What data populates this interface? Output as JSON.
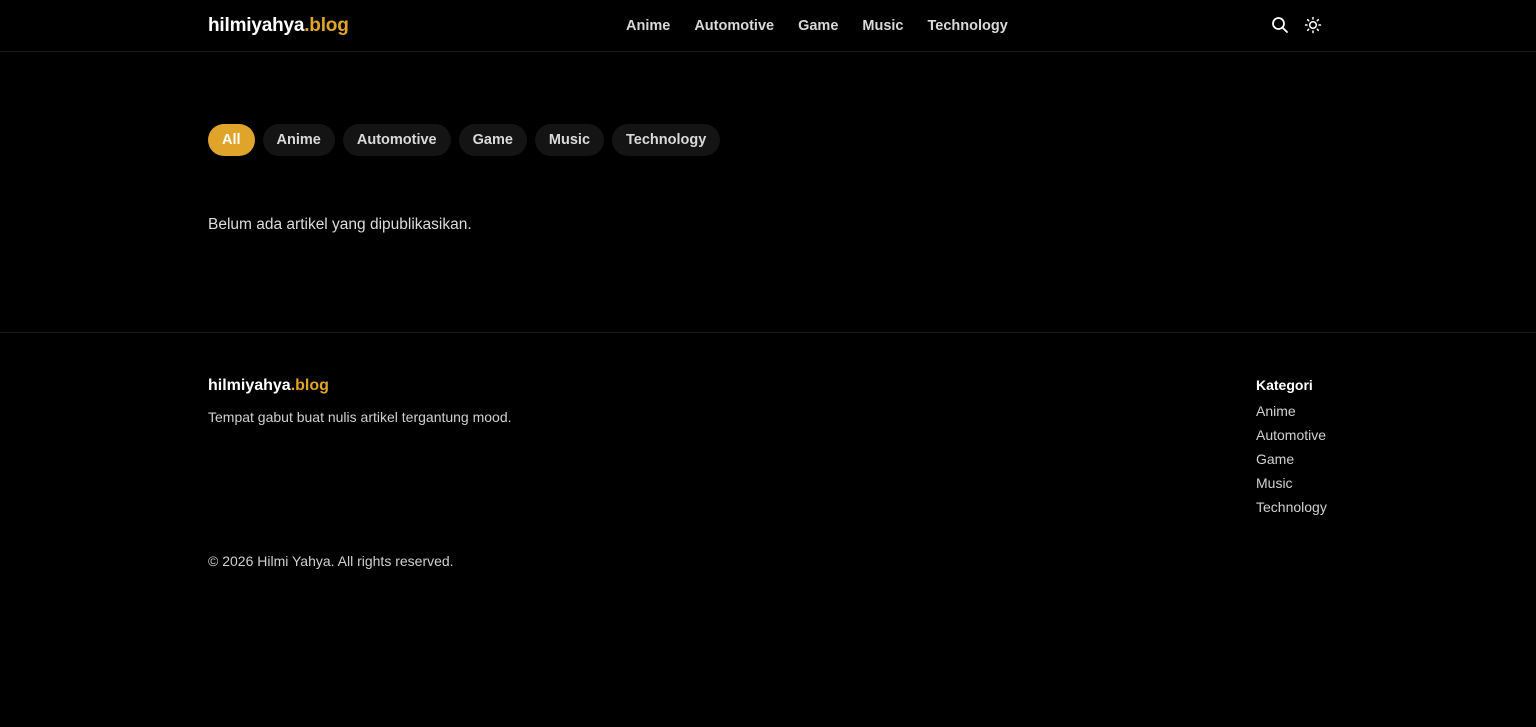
{
  "header": {
    "logo_name": "hilmiyahya",
    "logo_tld": ".blog",
    "nav": [
      "Anime",
      "Automotive",
      "Game",
      "Music",
      "Technology"
    ],
    "icons": [
      "search-icon",
      "sun-icon"
    ]
  },
  "filters": {
    "pills": [
      "All",
      "Anime",
      "Automotive",
      "Game",
      "Music",
      "Technology"
    ],
    "active": "All"
  },
  "main": {
    "empty_message": "Belum ada artikel yang dipublikasikan."
  },
  "footer": {
    "logo_name": "hilmiyahya",
    "logo_tld": ".blog",
    "tagline": "Tempat gabut buat nulis artikel tergantung mood.",
    "categories_title": "Kategori",
    "categories": [
      "Anime",
      "Automotive",
      "Game",
      "Music",
      "Technology"
    ],
    "copyright": "© 2026 Hilmi Yahya. All rights reserved."
  },
  "colors": {
    "background": "#000000",
    "accent": "#e0a42a",
    "pill_bg": "#141414"
  }
}
